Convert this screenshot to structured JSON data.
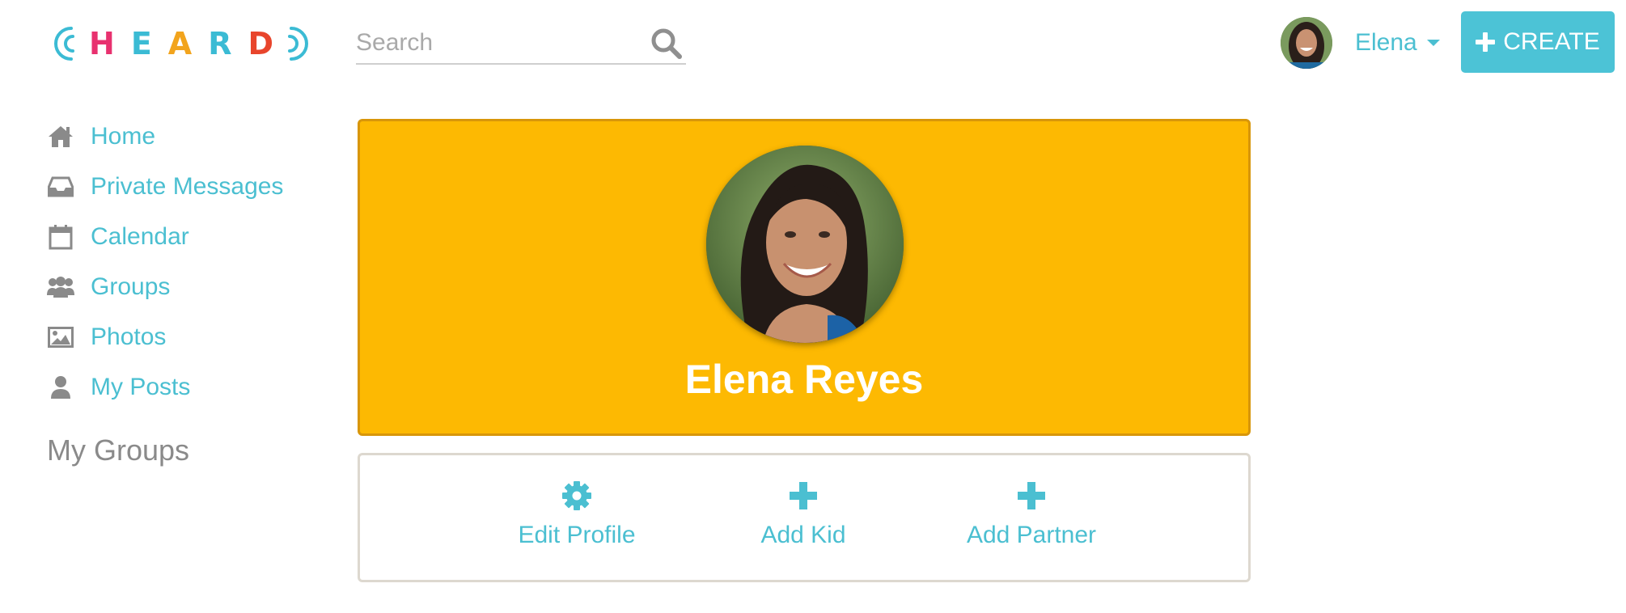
{
  "brand": {
    "logo_letters": [
      {
        "char": "H",
        "color": "#e8316f"
      },
      {
        "char": "E",
        "color": "#3bbbd4"
      },
      {
        "char": "A",
        "color": "#f2a41d"
      },
      {
        "char": "R",
        "color": "#3bbbd4"
      },
      {
        "char": "D",
        "color": "#e8452c"
      }
    ],
    "arc_color": "#3bbbd4"
  },
  "search": {
    "placeholder": "Search",
    "value": "",
    "icon": "search-icon"
  },
  "user": {
    "name": "Elena",
    "avatar": "avatar-photo"
  },
  "header": {
    "create_label": "CREATE",
    "create_icon": "plus-icon",
    "accent_color": "#4cc3d6"
  },
  "sidebar": {
    "items": [
      {
        "label": "Home",
        "icon": "home-icon"
      },
      {
        "label": "Private Messages",
        "icon": "inbox-icon"
      },
      {
        "label": "Calendar",
        "icon": "calendar-icon"
      },
      {
        "label": "Groups",
        "icon": "groups-icon"
      },
      {
        "label": "Photos",
        "icon": "photo-icon"
      },
      {
        "label": "My Posts",
        "icon": "user-icon"
      }
    ],
    "section_title": "My Groups"
  },
  "profile": {
    "name": "Elena Reyes",
    "background_color": "#fdb902"
  },
  "actions": [
    {
      "label": "Edit Profile",
      "icon": "gear-icon"
    },
    {
      "label": "Add Kid",
      "icon": "plus-icon"
    },
    {
      "label": "Add Partner",
      "icon": "plus-icon"
    }
  ]
}
